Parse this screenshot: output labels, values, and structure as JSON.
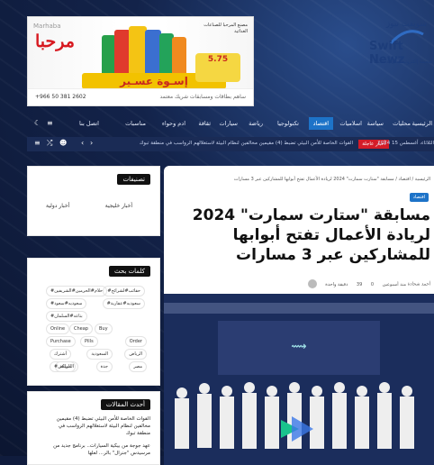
{
  "ad": {
    "brand_ar": "مرحبا",
    "brand_en": "Marhaba",
    "slogan": "إسـوة عسـير",
    "info": "مصنع المرحبا للصناعات الغذائية",
    "price": "5.75",
    "phone": "+966 50 381 2602",
    "footer": "ساهم بطاقات ومسابقات شريك معتمد"
  },
  "logo": {
    "name": "Swift Newz",
    "ar": "سويفت نيوز",
    "sub": "صحيفة إلكترونية سعودية شاملة"
  },
  "nav": {
    "items": [
      "الرئيسية",
      "محليات",
      "سياسة",
      "اسلاميات",
      "اقتصاد",
      "تكنولوجيا",
      "رياضة",
      "سيارات",
      "ثقافة",
      "ادم وحواء",
      "مناسبات",
      "اتصل بنا"
    ]
  },
  "ticker": {
    "date": "الثلاثاء، أغسطس 15 2024",
    "label": "أخبار عاجلة",
    "text": "القوات الخاصة للأمن البيئي تضبط (4) مقيمين مخالفين لنظام البيئة لاستغلالهم الرواسب في منطقة تبوك"
  },
  "sidebar": {
    "categories": {
      "title": "تصنيفات",
      "items": [
        "أخبار خليجية",
        "أخبار دولية"
      ]
    },
    "keywords": {
      "title": "كلمات بحث",
      "tags": [
        "#حقائب#لشرائح",
        "#حلام#الحرمين#الشريفين",
        "#سعوديه#عقارية",
        "#سعوديه#سعود",
        "#بتاعه#السلمان",
        "Online",
        "Cheap",
        "Buy",
        "Purchase",
        "Pills",
        "Order",
        "أشترك",
        "الرياض",
        "السعودية",
        "المملكة",
        "جدة",
        "مصر",
        "#الرياض"
      ]
    },
    "latest": {
      "title": "أحدث المقالات",
      "items": [
        "القوات الخاصة للأمن البيئي تضبط (4) مقيمين مخالفين لنظام البيئة لاستغلالهم الرواسب في منطقة تبوك",
        "عهد جوجة من بيكية السيارات.. برنامج جديد من مرسيدس \"جنرال\" بالر... لعلها"
      ]
    }
  },
  "article": {
    "breadcrumb": "الرئيسية / اقتصاد / مسابقة \"ستارت سمارت\" 2024 لريادة الأعمال تفتح أبوابها للمشاركين عبر 3 مسارات",
    "category": "اقتصاد",
    "title": "مسابقة \"ستارت سمارت\" 2024 لريادة الأعمال تفتح أبوابها للمشاركين عبر 3 مسارات",
    "author": "أحمد شحادة",
    "time": "منذ أسبوعين",
    "comments": "0",
    "views": "39",
    "read": "دقيقة واحدة"
  },
  "colors": {
    "accent": "#1d73c8",
    "breaking": "#d41c28"
  }
}
